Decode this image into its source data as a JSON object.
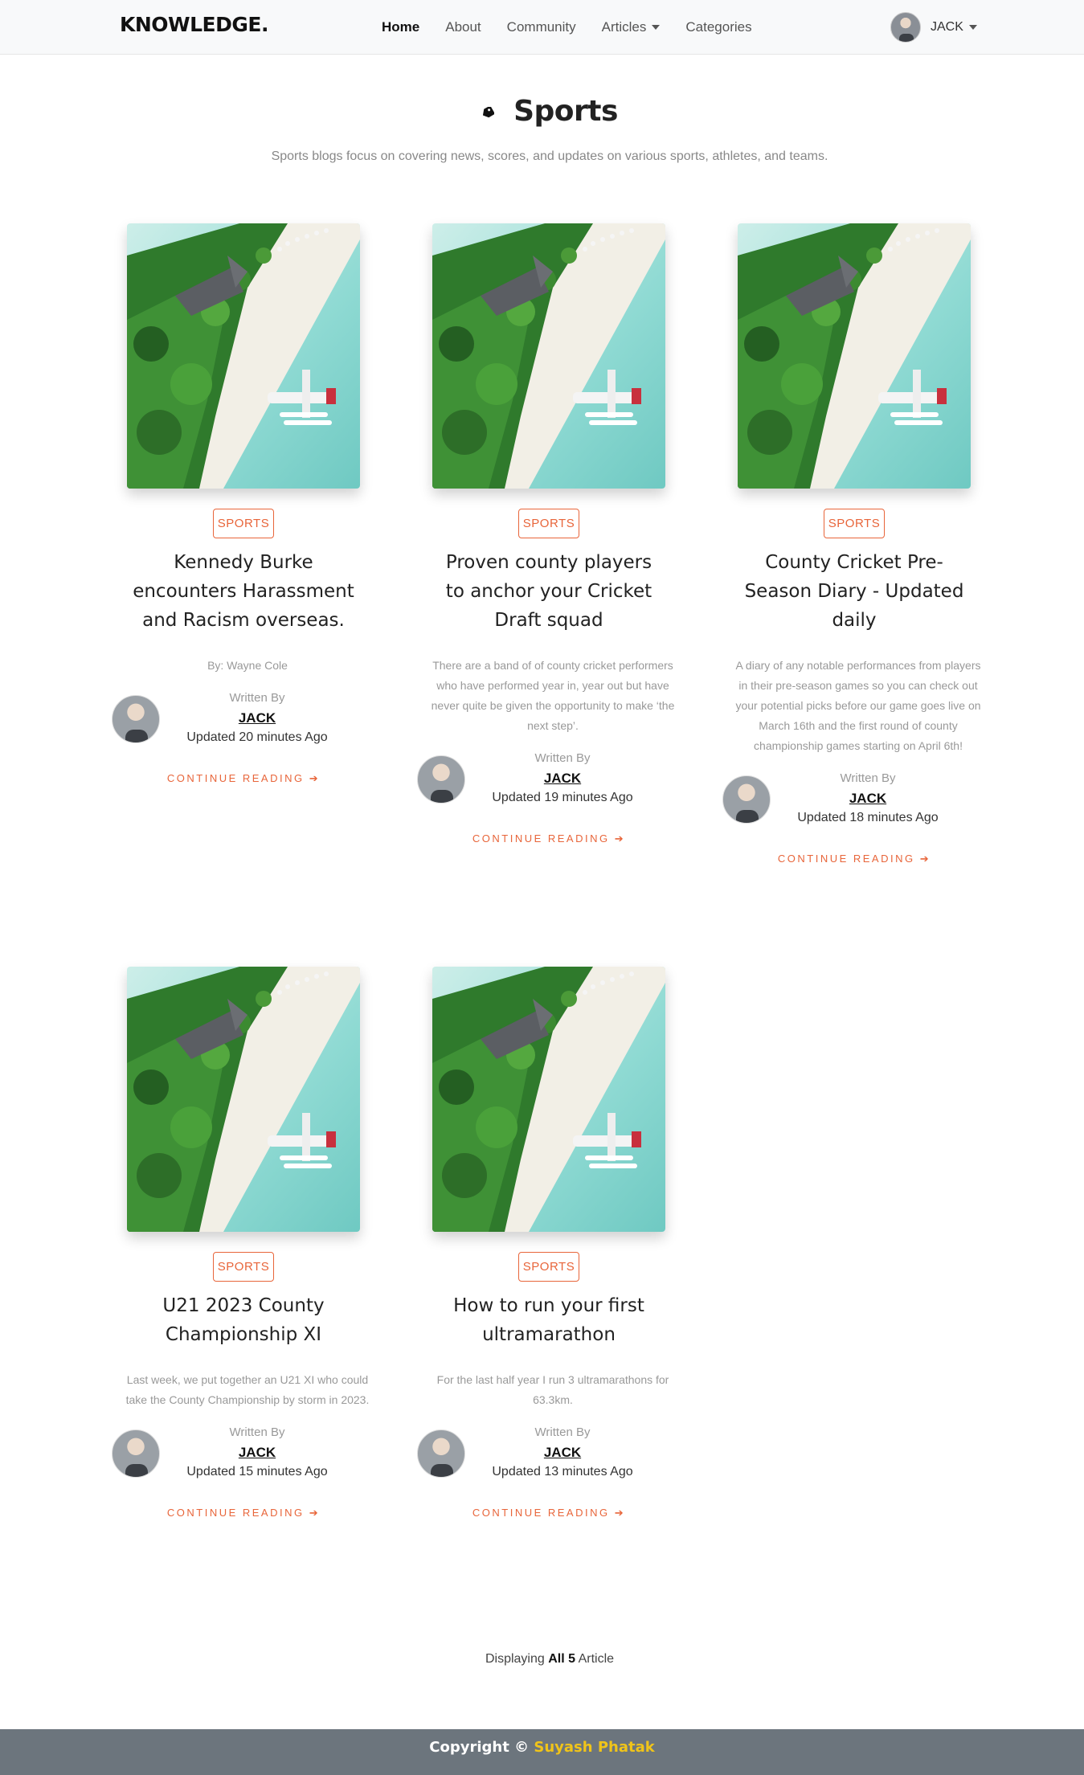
{
  "navbar": {
    "brand": "KNOWLEDGE.",
    "links": [
      {
        "label": "Home"
      },
      {
        "label": "About"
      },
      {
        "label": "Community"
      },
      {
        "label": "Articles"
      },
      {
        "label": "Categories"
      }
    ],
    "user_name": "JACK"
  },
  "header": {
    "title": "Sports",
    "subtitle": "Sports blogs focus on covering news, scores, and updates on various sports, athletes, and teams."
  },
  "articles": [
    {
      "category": "SPORTS",
      "title": "Kennedy Burke encounters Harassment and Racism overseas.",
      "description": "By: Wayne Cole",
      "written_by": "Written By",
      "author": "JACK",
      "updated": "Updated 20 minutes Ago",
      "continue": "CONTINUE READING ➔"
    },
    {
      "category": "SPORTS",
      "title": "Proven county players to anchor your Cricket Draft squad",
      "description": "There are a band of of county cricket performers who have performed year in, year out but have never quite be given the opportunity to make ‘the next step’.",
      "written_by": "Written By",
      "author": "JACK",
      "updated": "Updated 19 minutes Ago",
      "continue": "CONTINUE READING ➔"
    },
    {
      "category": "SPORTS",
      "title": "County Cricket Pre-Season Diary - Updated daily",
      "description": "A diary of any notable performances from players in their pre-season games so you can check out your potential picks before our game goes live on March 16th and the first round of county championship games starting on April 6th!",
      "written_by": "Written By",
      "author": "JACK",
      "updated": "Updated 18 minutes Ago",
      "continue": "CONTINUE READING ➔"
    },
    {
      "category": "SPORTS",
      "title": "U21 2023 County Championship XI",
      "description": "Last week, we put together an U21 XI who could take the County Championship by storm in 2023.",
      "written_by": "Written By",
      "author": "JACK",
      "updated": "Updated 15 minutes Ago",
      "continue": "CONTINUE READING ➔"
    },
    {
      "category": "SPORTS",
      "title": "How to run your first ultramarathon",
      "description": "For the last half year I run 3 ultramarathons for 63.3km.",
      "written_by": "Written By",
      "author": "JACK",
      "updated": "Updated 13 minutes Ago",
      "continue": "CONTINUE READING ➔"
    }
  ],
  "summary": {
    "prefix": "Displaying",
    "all": "All",
    "count": "5",
    "suffix": "Article"
  },
  "footer": {
    "copyright": "Copyright ©",
    "author": "Suyash Phatak"
  },
  "colors": {
    "accent": "#e8653a",
    "footer_bg": "#6c757d",
    "footer_author": "#f0c419"
  }
}
